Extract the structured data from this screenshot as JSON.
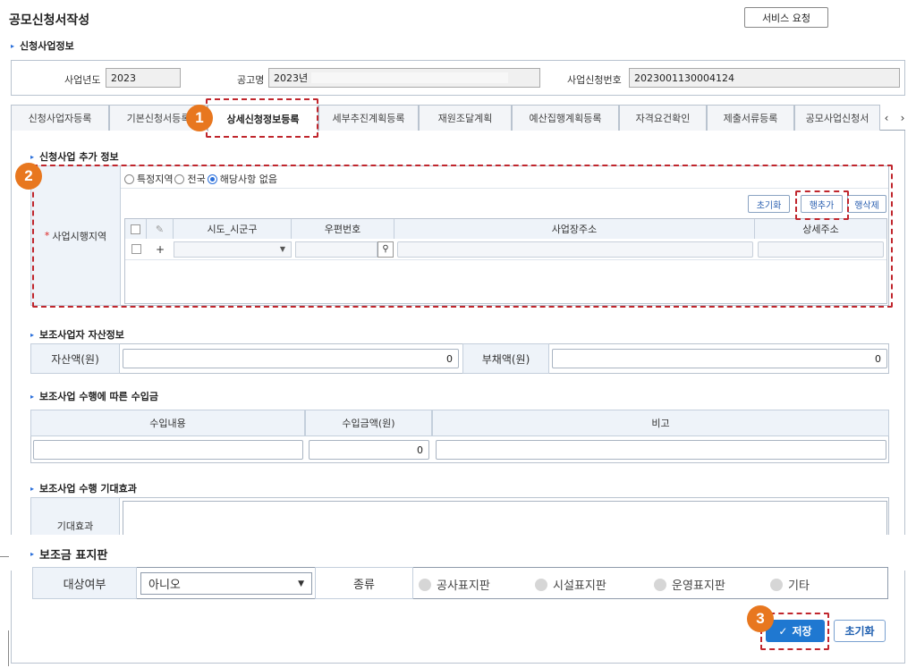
{
  "page_title": "공모신청서작성",
  "service_request": "서비스 요청",
  "basic_info": {
    "section_title": "신청사업정보",
    "year_label": "사업년도",
    "year_value": "2023",
    "notice_label": "공고명",
    "notice_value": "2023년",
    "app_no_label": "사업신청번호",
    "app_no_value": "2023001130004124"
  },
  "tabs": [
    "신청사업자등록",
    "기본신청서등록",
    "상세신청정보등록",
    "세부추진계획등록",
    "재원조달계획",
    "예산집행계획등록",
    "자격요건확인",
    "제출서류등록",
    "공모사업신청서"
  ],
  "active_tab": "상세신청정보등록",
  "tab_scroll_left": "‹",
  "tab_scroll_right": "›",
  "additional": {
    "section_title": "신청사업 추가 정보",
    "required_mark": "*",
    "area_label": "사업시행지역",
    "radio_options": [
      "특정지역",
      "전국",
      "해당사항 없음"
    ],
    "selected_radio": "해당사항 없음",
    "btn_reset": "초기화",
    "btn_add_row": "행추가",
    "btn_del_row": "행삭제",
    "grid_headers": [
      "시도_시군구",
      "우편번호",
      "사업장주소",
      "상세주소"
    ],
    "row_add_symbol": "+",
    "select_arrow": "▼"
  },
  "assets": {
    "section_title": "보조사업자 자산정보",
    "asset_label": "자산액(원)",
    "asset_value": "0",
    "debt_label": "부채액(원)",
    "debt_value": "0"
  },
  "revenue": {
    "section_title": "보조사업 수행에 따른 수입금",
    "col_content": "수입내용",
    "col_amount": "수입금액(원)",
    "col_note": "비고",
    "amount_value": "0"
  },
  "effect": {
    "section_title": "보조사업 수행 기대효과",
    "label": "기대효과"
  },
  "sign": {
    "section_title": "보조금 표지판",
    "target_label": "대상여부",
    "target_value": "아니오",
    "type_label": "종류",
    "types": [
      "공사표지판",
      "시설표지판",
      "운영표지판",
      "기타"
    ]
  },
  "actions": {
    "save": "저장",
    "save_check": "✓",
    "reset": "초기화"
  },
  "callouts": [
    "1",
    "2",
    "3"
  ],
  "colors": {
    "accent": "#1f78d1",
    "callout": "#e8771f",
    "highlight": "#c0262d"
  }
}
